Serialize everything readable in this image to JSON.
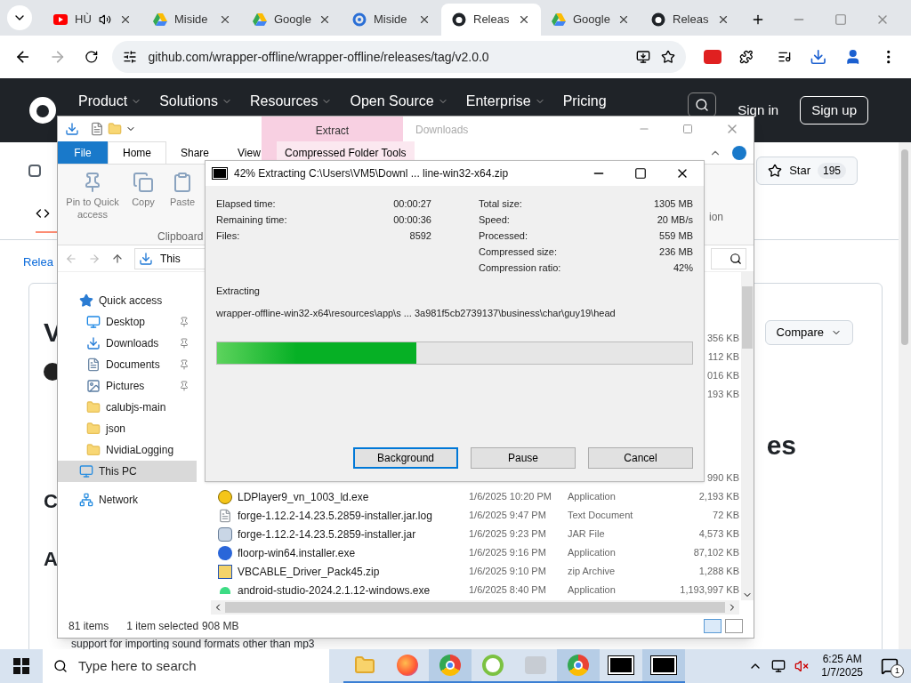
{
  "browser": {
    "tabs": [
      {
        "title": "HÙ",
        "audio": true,
        "selected": false
      },
      {
        "title": "Miside",
        "audio": false,
        "selected": false
      },
      {
        "title": "Google",
        "audio": false,
        "selected": false
      },
      {
        "title": "Miside",
        "audio": false,
        "selected": false
      },
      {
        "title": "Releas",
        "audio": false,
        "selected": true
      },
      {
        "title": "Google",
        "audio": false,
        "selected": false
      },
      {
        "title": "Releas",
        "audio": false,
        "selected": false
      }
    ],
    "url": "github.com/wrapper-offline/wrapper-offline/releases/tag/v2.0.0"
  },
  "github": {
    "nav": [
      "Product",
      "Solutions",
      "Resources",
      "Open Source",
      "Enterprise",
      "Pricing"
    ],
    "sign_in": "Sign in",
    "sign_up": "Sign up",
    "star": "Star",
    "star_count": "195",
    "crumb": "Relea",
    "heading": "V",
    "compare": "Compare",
    "heading2": "es",
    "letters": [
      "C",
      "A"
    ],
    "bottom_text": "support for importing sound formats other than mp3"
  },
  "explorer": {
    "title": "Downloads",
    "context_tab": "Extract",
    "ribbon_tabs": [
      {
        "label": "File",
        "kind": "file",
        "selected": false
      },
      {
        "label": "Home",
        "kind": "tab",
        "selected": true
      },
      {
        "label": "Share",
        "kind": "tab",
        "selected": false
      },
      {
        "label": "View",
        "kind": "tab",
        "selected": false
      },
      {
        "label": "Compressed Folder Tools",
        "kind": "context",
        "selected": false
      }
    ],
    "ribbon_buttons": [
      "Pin to Quick access",
      "Copy",
      "Paste"
    ],
    "group": "Clipboard",
    "partial": "ion",
    "address": "This",
    "nav": [
      {
        "label": "Quick access",
        "pinned": false,
        "selected": false,
        "children": [
          {
            "label": "Desktop",
            "pinned": true,
            "selected": false
          },
          {
            "label": "Downloads",
            "pinned": true,
            "selected": false
          },
          {
            "label": "Documents",
            "pinned": true,
            "selected": false
          },
          {
            "label": "Pictures",
            "pinned": true,
            "selected": false
          },
          {
            "label": "calubjs-main",
            "pinned": false,
            "selected": false
          },
          {
            "label": "json",
            "pinned": false,
            "selected": false
          },
          {
            "label": "NvidiaLogging",
            "pinned": false,
            "selected": false
          }
        ]
      },
      {
        "label": "This PC",
        "pinned": false,
        "selected": true
      },
      {
        "label": "Network",
        "pinned": false,
        "selected": false
      }
    ],
    "files_upper": [
      {
        "size": "356 KB"
      },
      {
        "size": "112 KB"
      },
      {
        "size": "016 KB"
      },
      {
        "size": "193 KB"
      }
    ],
    "file_mid": {
      "size": "990 KB"
    },
    "files": [
      {
        "name": "LDPlayer9_vn_1003_ld.exe",
        "date": "1/6/2025 10:20 PM",
        "type": "Application",
        "size": "2,193 KB"
      },
      {
        "name": "forge-1.12.2-14.23.5.2859-installer.jar.log",
        "date": "1/6/2025 9:47 PM",
        "type": "Text Document",
        "size": "72 KB"
      },
      {
        "name": "forge-1.12.2-14.23.5.2859-installer.jar",
        "date": "1/6/2025 9:23 PM",
        "type": "JAR File",
        "size": "4,573 KB"
      },
      {
        "name": "floorp-win64.installer.exe",
        "date": "1/6/2025 9:16 PM",
        "type": "Application",
        "size": "87,102 KB"
      },
      {
        "name": "VBCABLE_Driver_Pack45.zip",
        "date": "1/6/2025 9:10 PM",
        "type": "zip Archive",
        "size": "1,288 KB"
      },
      {
        "name": "android-studio-2024.2.1.12-windows.exe",
        "date": "1/6/2025 8:40 PM",
        "type": "Application",
        "size": "1,193,997 KB"
      }
    ],
    "status_items": "81 items",
    "status_selected": "1 item selected",
    "status_size": "908 MB"
  },
  "dialog": {
    "title": "42% Extracting C:\\Users\\VM5\\Downl ... line-win32-x64.zip",
    "stats_left": [
      {
        "label": "Elapsed time:",
        "value": "00:00:27"
      },
      {
        "label": "Remaining time:",
        "value": "00:00:36"
      },
      {
        "label": "Files:",
        "value": "8592"
      }
    ],
    "stats_right": [
      {
        "label": "Total size:",
        "value": "1305 MB"
      },
      {
        "label": "Speed:",
        "value": "20 MB/s"
      },
      {
        "label": "Processed:",
        "value": "559 MB"
      },
      {
        "label": "Compressed size:",
        "value": "236 MB"
      },
      {
        "label": "Compression ratio:",
        "value": "42%"
      }
    ],
    "extracting_label": "Extracting",
    "path": "wrapper-offline-win32-x64\\resources\\app\\s ... 3a981f5cb2739137\\business\\char\\guy19\\head",
    "level": 0.42,
    "buttons": [
      {
        "label": "Background",
        "focused": true
      },
      {
        "label": "Pause",
        "focused": false
      },
      {
        "label": "Cancel",
        "focused": false
      }
    ]
  },
  "taskbar": {
    "search": "Type here to search",
    "apps": [
      {
        "kind": "explorer",
        "active": false
      },
      {
        "kind": "firefox",
        "active": false
      },
      {
        "kind": "chrome",
        "active": true
      },
      {
        "kind": "green",
        "active": false
      },
      {
        "kind": "grey",
        "active": false
      },
      {
        "kind": "chrome",
        "active": true
      },
      {
        "kind": "archiver",
        "active": false
      },
      {
        "kind": "archiver",
        "active": true
      }
    ],
    "time": "6:25 AM",
    "date": "1/7/2025",
    "notifications": "1"
  }
}
